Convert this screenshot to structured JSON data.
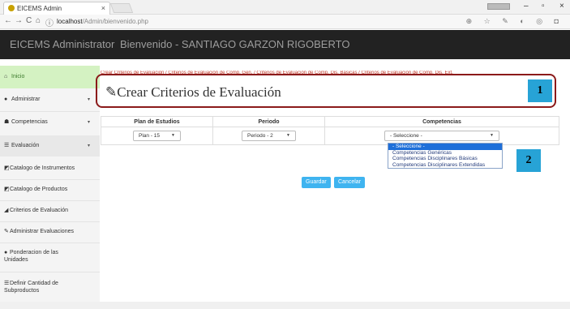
{
  "browser": {
    "tab_title": "EICEMS Admin",
    "tab_close": "×",
    "url_host": "localhost",
    "url_path": "/Admin/bienvenido.php",
    "back": "←",
    "forward": "→",
    "reload": "C",
    "home": "⌂",
    "info": "ⓘ",
    "addr_icons": "⊕ ☆ ✎ ◐ ◎ ◘",
    "min": "–",
    "restore": "▫",
    "close": "×"
  },
  "header": {
    "brand": "EICEMS Administrator",
    "welcome": "Bienvenido - SANTIAGO GARZON RIGOBERTO"
  },
  "sidebar": {
    "items": [
      {
        "label": "Inicio",
        "icon": "home-icon",
        "glyph": "⌂"
      },
      {
        "label": "Administrar",
        "icon": "circle-icon",
        "glyph": "●",
        "caret": "▾"
      },
      {
        "label": "Competencias",
        "icon": "users-icon",
        "glyph": "☗",
        "caret": "▾"
      },
      {
        "label": "Evaluación",
        "icon": "list-icon",
        "glyph": "☰",
        "caret": "▾"
      },
      {
        "label": "Catalogo de Instrumentos",
        "icon": "book-icon",
        "glyph": "◩"
      },
      {
        "label": "Catalogo de Productos",
        "icon": "book-icon",
        "glyph": "◩"
      },
      {
        "label": "Criterios de Evaluación",
        "icon": "tag-icon",
        "glyph": "◢"
      },
      {
        "label": "Administrar Evaluaciones",
        "icon": "edit-icon",
        "glyph": "✎"
      },
      {
        "label": "Ponderacion de las",
        "label2": "Unidades",
        "icon": "circle-icon",
        "glyph": "●"
      },
      {
        "label": "Definir Cantidad de",
        "label2": "Subproductos",
        "icon": "list-icon",
        "glyph": "☰"
      }
    ]
  },
  "breadcrumb": "Crear Criterios de Evaluación  /  Criterios de Evaluación de Comp. Gen.  /  Criterios de Evaluación de Comp. Dis. Básicas  /  Criterios de Evaluación de Comp. Dis. Ext.",
  "page": {
    "title_icon": "✎",
    "title": "Crear Criterios de Evaluación"
  },
  "markers": {
    "m1": "1",
    "m2": "2"
  },
  "table": {
    "headers": [
      "Plan de Estudios",
      "Periodo",
      "Competencias"
    ],
    "plan_value": "Plan - 15",
    "periodo_value": "Periodo - 2",
    "competencias_value": "- Seleccione -"
  },
  "dropdown": {
    "options": [
      "- Seleccione -",
      "Competencias Genéricas",
      "Competencias Disciplinares Básicas",
      "Competencias Disciplinares Extendidas"
    ]
  },
  "buttons": {
    "save": "Guardar",
    "cancel": "Cancelar"
  },
  "colors": {
    "accent": "#3fb4f0",
    "header_bg": "#222222",
    "active_bg": "#d4f2c2",
    "highlight_border": "#8b1a1a",
    "marker_bg": "#27a3d6"
  }
}
